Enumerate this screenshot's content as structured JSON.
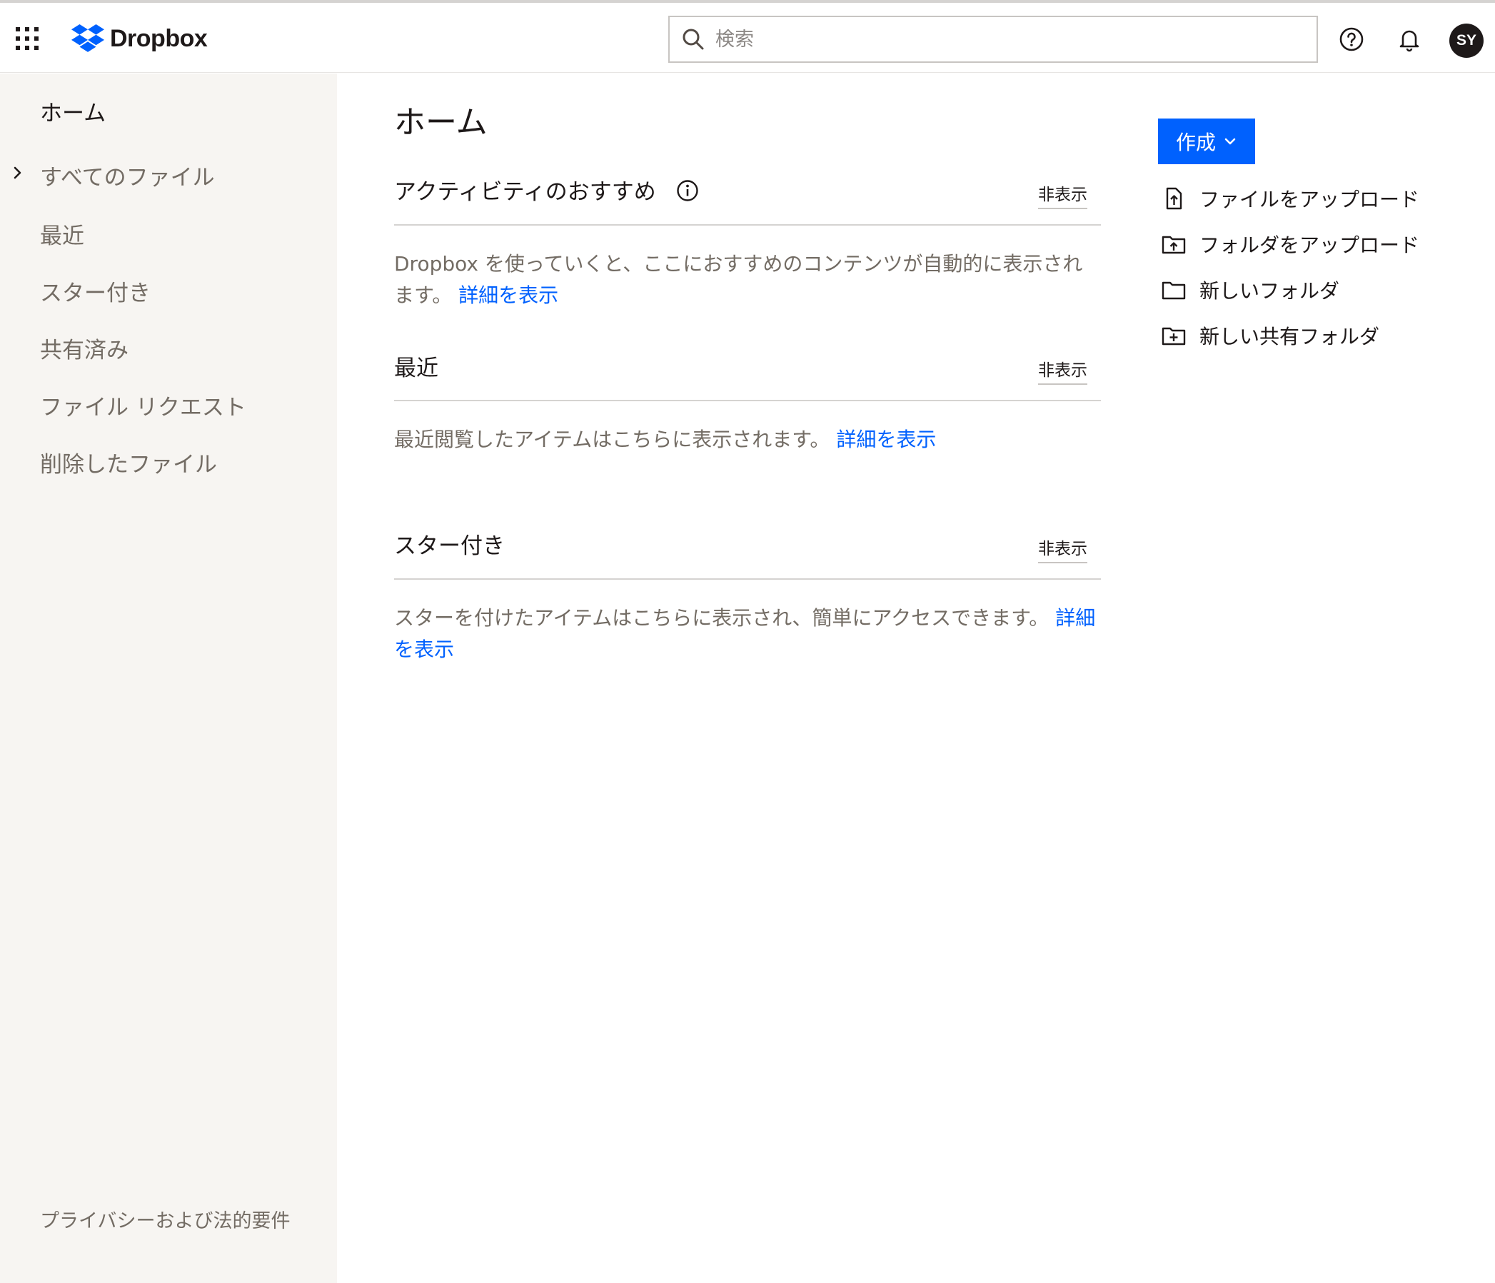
{
  "header": {
    "app_name": "Dropbox",
    "search_placeholder": "検索",
    "avatar_initials": "SY"
  },
  "sidebar": {
    "items": [
      {
        "label": "ホーム",
        "active": true
      },
      {
        "label": "すべてのファイル"
      },
      {
        "label": "最近"
      },
      {
        "label": "スター付き"
      },
      {
        "label": "共有済み"
      },
      {
        "label": "ファイル リクエスト"
      },
      {
        "label": "削除したファイル"
      }
    ],
    "footer": "プライバシーおよび法的要件"
  },
  "main": {
    "title": "ホーム",
    "sections": [
      {
        "title": "アクティビティのおすすめ",
        "hide_label": "非表示",
        "body": "Dropbox を使っていくと、ここにおすすめのコンテンツが自動的に表示されます。",
        "link": "詳細を表示"
      },
      {
        "title": "最近",
        "hide_label": "非表示",
        "body": "最近閲覧したアイテムはこちらに表示されます。",
        "link": "詳細を表示"
      },
      {
        "title": "スター付き",
        "hide_label": "非表示",
        "body": "スターを付けたアイテムはこちらに表示され、簡単にアクセスできます。",
        "link": "詳細を表示"
      }
    ]
  },
  "actions": {
    "create_label": "作成",
    "items": [
      {
        "label": "ファイルをアップロード",
        "icon": "file-upload-icon"
      },
      {
        "label": "フォルダをアップロード",
        "icon": "folder-upload-icon"
      },
      {
        "label": "新しいフォルダ",
        "icon": "folder-icon"
      },
      {
        "label": "新しい共有フォルダ",
        "icon": "shared-folder-plus-icon"
      }
    ]
  },
  "colors": {
    "accent": "#0061fe",
    "sidebar_bg": "#f7f5f2",
    "text_primary": "#1e1919",
    "text_secondary": "#736c64"
  }
}
